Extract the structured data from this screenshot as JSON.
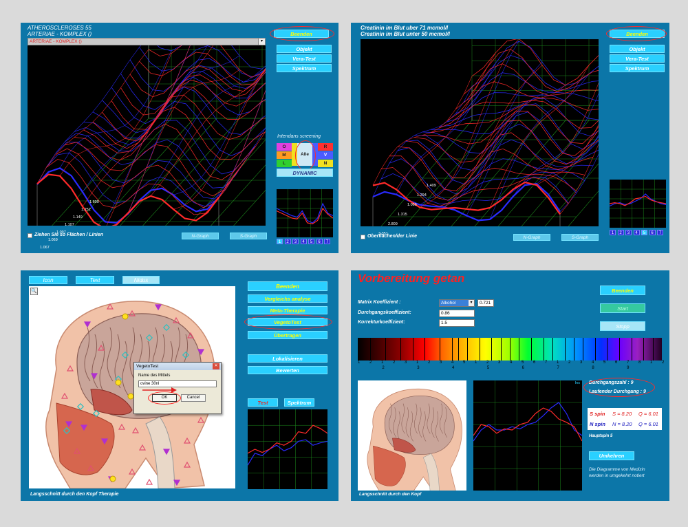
{
  "panel1": {
    "title_line1": "ATHEROSCLEROSES 55",
    "title_line2": "ARTERIAE - KOMPLEX ()",
    "dropdown_value": "ARTERIAE - KOMPLEX ()",
    "buttons": {
      "beenden": "Beenden",
      "objekt": "Objekt",
      "vera_test": "Vera-Test",
      "spektrum": "Spektrum"
    },
    "screening_title": "Intendans screening",
    "screening_grid": [
      {
        "label": "O",
        "color": "#e040e0"
      },
      {
        "label": "Alle",
        "color": "#cfe9f5"
      },
      {
        "label": "R",
        "color": "#ff3030"
      },
      {
        "label": "M",
        "color": "#ff9a20"
      },
      {
        "label": "V",
        "color": "#4a5cff"
      },
      {
        "label": "L",
        "color": "#30d030"
      },
      {
        "label": "N",
        "color": "#f0e020"
      }
    ],
    "dynamic_label": "DYNAMIC",
    "axis_labels": [
      "1.600",
      "1.252",
      "1.149",
      "1.107",
      "1.097",
      "1.069",
      "1.067"
    ],
    "checkbox_label": "Ziehen Sie so Flächen / Linien",
    "n_graph": "N-Graph",
    "s_graph": "S-Graph",
    "tabs": [
      "1",
      "2",
      "3",
      "4",
      "5",
      "6",
      "7"
    ]
  },
  "panel2": {
    "title_line1": "Creatinin im Blut uber 71 mcmol/l",
    "title_line2": "Creatinin im Blut unter 50 mcmol/l",
    "buttons": {
      "beenden": "Beenden",
      "objekt": "Objekt",
      "vera_test": "Vera-Test",
      "spektrum": "Spektrum"
    },
    "axis_labels": [
      "1.409",
      "1.294",
      "1.066",
      "1.315",
      "2.809",
      "3.351"
    ],
    "checkbox_label": "Oberflächen/der Linie",
    "n_graph": "N-Graph",
    "s_graph": "S-Graph",
    "tabs": [
      "1",
      "2",
      "3",
      "4",
      "5",
      "6",
      "7"
    ]
  },
  "panel3": {
    "tabs": {
      "icon": "Icon",
      "text": "Text",
      "nidus": "Nidus"
    },
    "buttons": {
      "beenden": "Beenden",
      "vergleichs": "Vergleichs analyse",
      "meta": "Meta-Therapie",
      "vegeto": "VegetoTest",
      "uebertragen": "Übertragen",
      "lokalisieren": "Lokalisieren",
      "bewerten": "Bewerten"
    },
    "dialog": {
      "title": "VegetoTest",
      "field_label": "Name des Mittels",
      "field_value": "ovine 30nl",
      "ok": "OK",
      "cancel": "Cancel"
    },
    "chart_tabs": {
      "test": "Test",
      "spektrum": "Spektrum"
    },
    "caption": "Langsschnitt durch den Kopf  Therapie"
  },
  "panel4": {
    "title": "Vorbereitung getan",
    "fields": [
      {
        "label": "Matrix Koeffizient :",
        "value": "Alkohol",
        "extra": "0.721"
      },
      {
        "label": "Durchgangskoeffizient:",
        "value": "0.86"
      },
      {
        "label": "Korrekturkoeffizient:",
        "value": "1.5"
      }
    ],
    "buttons": {
      "beenden": "Beenden",
      "start": "Start",
      "stopp": "Stopp",
      "umkehren": "Umkehren"
    },
    "spectrum_numbers": [
      "1",
      "2",
      "1",
      "2",
      "3",
      "1",
      "2",
      "3",
      "4",
      "5",
      "1",
      "2",
      "3",
      "4",
      "5",
      "6",
      "7",
      "1",
      "2",
      "3",
      "4",
      "5",
      "6",
      "7",
      "8",
      "1",
      "2"
    ],
    "spectrum_lower_numbers": [
      "2",
      "3",
      "4",
      "5",
      "6",
      "7",
      "8",
      "9"
    ],
    "chart_corner_label": "Ins",
    "durchgangszahl": "Durchgangszahl : 9",
    "laufender": "Laufender Durchgang : 9",
    "s_spin": {
      "label": "S spin",
      "s": "S = 8.20",
      "q": "Q = 6.01"
    },
    "n_spin": {
      "label": "N spin",
      "n": "N = 8.20",
      "q": "Q = 6.01"
    },
    "hauptspin": "Hauptspin 5",
    "note_line1": "Die Diagramme von Medizin",
    "note_line2": "werden in umgekehrt notiert",
    "caption": "Langsschnitt durch den Kopf"
  }
}
